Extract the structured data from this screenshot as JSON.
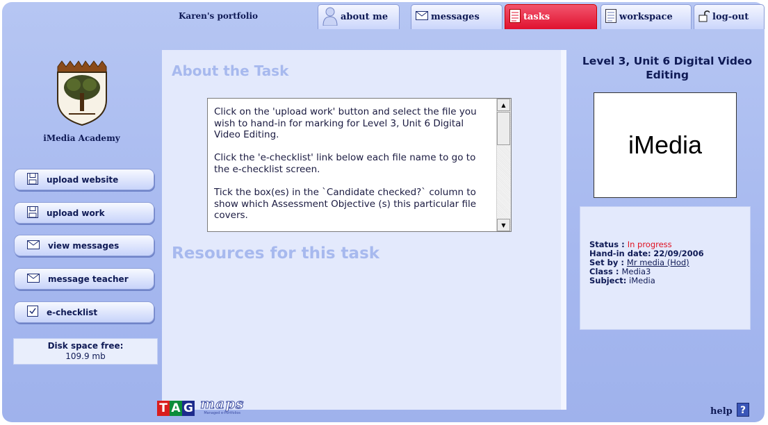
{
  "header": {
    "portfolio_title": "Karen's portfolio",
    "tabs": [
      {
        "label": "about me",
        "icon": "person-icon"
      },
      {
        "label": "messages",
        "icon": "envelope-icon"
      },
      {
        "label": "tasks",
        "icon": "task-list-icon",
        "active": true
      },
      {
        "label": "workspace",
        "icon": "workspace-icon"
      },
      {
        "label": "log-out",
        "icon": "padlock-icon"
      }
    ]
  },
  "sidebar": {
    "school_name": "iMedia Academy",
    "buttons": [
      {
        "label": "upload website",
        "icon": "floppy-disk-icon"
      },
      {
        "label": "upload work",
        "icon": "floppy-disk-icon"
      },
      {
        "label": "view messages",
        "icon": "envelope-icon"
      },
      {
        "label": "message teacher",
        "icon": "envelope-icon"
      },
      {
        "label": "e-checklist",
        "icon": "checkbox-icon"
      }
    ],
    "disk_label": "Disk space free:",
    "disk_value": "109.9 mb"
  },
  "main": {
    "about_heading": "About the Task",
    "task_text": "Click on the 'upload work' button and select the file you wish to hand-in for marking for Level 3, Unit 6 Digital Video Editing.\n\nClick the 'e-checklist' link below each file name to go to the e-checklist screen.\n\nTick the box(es) in the `Candidate checked?` column to show which Assessment Objective (s) this particular file covers.",
    "resources_heading": "Resources for this task"
  },
  "task_panel": {
    "unit_title": "Level 3, Unit 6 Digital Video Editing",
    "image_text": "iMedia",
    "status_label": "Status",
    "status_value": "In progress",
    "handin_label": "Hand-in date:",
    "handin_value": "22/09/2006",
    "setby_label": "Set by",
    "setby_value": "Mr media (Hod)",
    "class_label": "Class",
    "class_value": "Media3",
    "subject_label": "Subject:",
    "subject_value": "iMedia"
  },
  "footer": {
    "tag_letters": [
      "T",
      "A",
      "G"
    ],
    "maps_logo_text": "maps",
    "maps_tagline": "Managed e-Portfolios",
    "help_label": "help"
  },
  "colors": {
    "frame_bg": "#a9baf0",
    "panel_bg": "#e3e9fc",
    "active_tab": "#e8203c",
    "heading_text": "#a7b9ee",
    "status_red": "#e01020"
  }
}
